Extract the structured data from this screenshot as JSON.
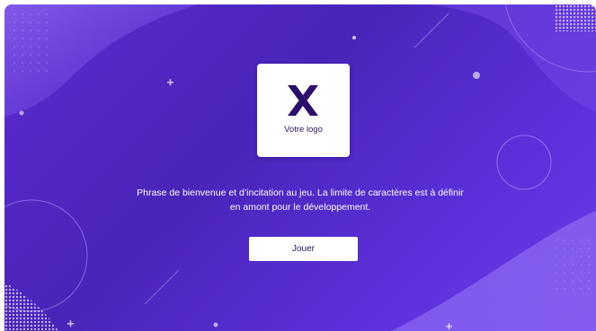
{
  "logo": {
    "text": "Votre logo",
    "icon": "x-logo-icon",
    "icon_color": "#2a0f6a"
  },
  "welcome": {
    "text": "Phrase de bienvenue et d’incitation au jeu. La limite de caractères est à définir en amont pour le développement."
  },
  "play_button": {
    "label": "Jouer"
  },
  "colors": {
    "background_start": "#5b2bd0",
    "background_end": "#6b3bea",
    "accent_light": "#8a63f0",
    "text_light": "#ffffff",
    "text_dark": "#2a1560"
  }
}
